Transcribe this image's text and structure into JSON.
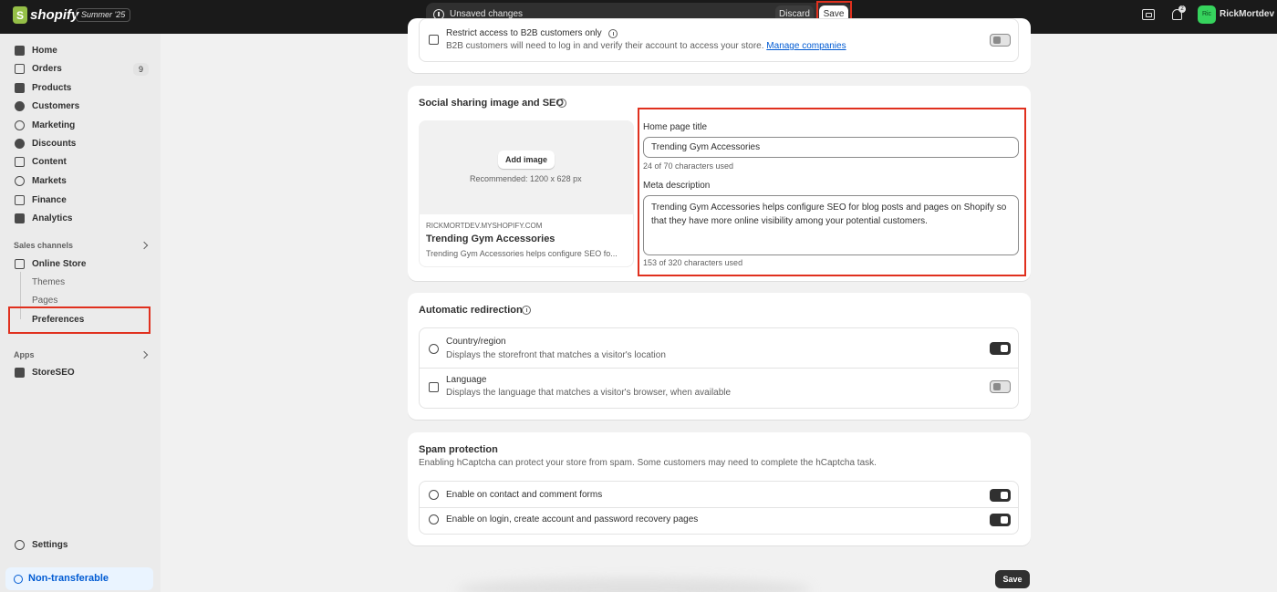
{
  "topbar": {
    "logo_text": "shopify",
    "edition": "Summer '25",
    "unsaved_text": "Unsaved changes",
    "discard_label": "Discard",
    "save_label": "Save",
    "notification_count": "2",
    "avatar_initials": "Ric",
    "username": "RickMortdev"
  },
  "sidebar": {
    "items": [
      {
        "label": "Home",
        "icon": "home-icon"
      },
      {
        "label": "Orders",
        "icon": "orders-icon",
        "count": "9"
      },
      {
        "label": "Products",
        "icon": "tag-icon"
      },
      {
        "label": "Customers",
        "icon": "person-icon"
      },
      {
        "label": "Marketing",
        "icon": "target-icon"
      },
      {
        "label": "Discounts",
        "icon": "discount-icon"
      },
      {
        "label": "Content",
        "icon": "content-icon"
      },
      {
        "label": "Markets",
        "icon": "globe-icon"
      },
      {
        "label": "Finance",
        "icon": "bank-icon"
      },
      {
        "label": "Analytics",
        "icon": "chart-icon"
      }
    ],
    "sales_channels_label": "Sales channels",
    "online_store_label": "Online Store",
    "sub_items": [
      "Themes",
      "Pages",
      "Preferences"
    ],
    "apps_label": "Apps",
    "storeseo_label": "StoreSEO",
    "settings_label": "Settings",
    "non_transferable_label": "Non-transferable"
  },
  "b2b": {
    "title": "Restrict access to B2B customers only",
    "desc": "B2B customers will need to log in and verify their account to access your store.",
    "link": "Manage companies"
  },
  "seo": {
    "title": "Social sharing image and SEO",
    "add_image": "Add image",
    "recommended": "Recommended: 1200 x 628 px",
    "preview_domain": "RICKMORTDEV.MYSHOPIFY.COM",
    "preview_title": "Trending Gym Accessories",
    "preview_desc": "Trending Gym Accessories helps configure SEO fo...",
    "home_title_label": "Home page title",
    "home_title_value": "Trending Gym Accessories",
    "home_title_counter": "24 of 70 characters used",
    "meta_label": "Meta description",
    "meta_value": "Trending Gym Accessories helps configure SEO for blog posts and pages on Shopify so that they have more online visibility among your potential customers.",
    "meta_counter": "153 of 320 characters used"
  },
  "redirection": {
    "title": "Automatic redirection",
    "rows": [
      {
        "title": "Country/region",
        "desc": "Displays the storefront that matches a visitor's location",
        "enabled": true
      },
      {
        "title": "Language",
        "desc": "Displays the language that matches a visitor's browser, when available",
        "enabled": false
      }
    ]
  },
  "spam": {
    "title": "Spam protection",
    "desc": "Enabling hCaptcha can protect your store from spam. Some customers may need to complete the hCaptcha task.",
    "rows": [
      {
        "title": "Enable on contact and comment forms",
        "enabled": true
      },
      {
        "title": "Enable on login, create account and password recovery pages",
        "enabled": true
      }
    ]
  },
  "footer": {
    "save_label": "Save"
  }
}
